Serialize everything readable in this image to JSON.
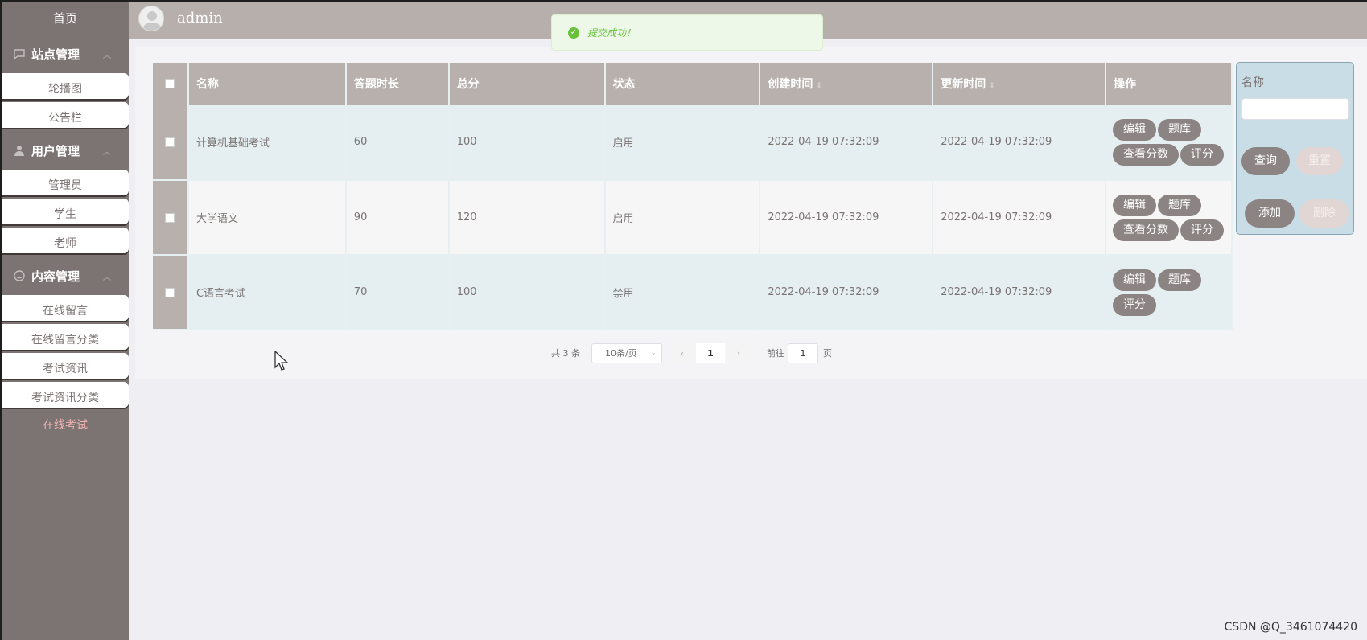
{
  "sidebar": {
    "home": "首页",
    "groups": [
      {
        "title": "站点管理",
        "items": [
          "轮播图",
          "公告栏"
        ]
      },
      {
        "title": "用户管理",
        "items": [
          "管理员",
          "学生",
          "老师"
        ]
      },
      {
        "title": "内容管理",
        "items": [
          "在线留言",
          "在线留言分类",
          "考试资讯",
          "考试资讯分类"
        ]
      }
    ],
    "active": "在线考试"
  },
  "header": {
    "username": "admin"
  },
  "toast": {
    "message": "提交成功！"
  },
  "table": {
    "columns": [
      "名称",
      "答题时长",
      "总分",
      "状态",
      "创建时间",
      "更新时间",
      "操作"
    ],
    "rows": [
      {
        "name": "计算机基础考试",
        "duration": "60",
        "score": "100",
        "status": "启用",
        "created": "2022-04-19 07:32:09",
        "updated": "2022-04-19 07:32:09",
        "actions": [
          [
            "编辑",
            "题库"
          ],
          [
            "查看分数",
            "评分"
          ]
        ]
      },
      {
        "name": "大学语文",
        "duration": "90",
        "score": "120",
        "status": "启用",
        "created": "2022-04-19 07:32:09",
        "updated": "2022-04-19 07:32:09",
        "actions": [
          [
            "编辑",
            "题库"
          ],
          [
            "查看分数",
            "评分"
          ]
        ]
      },
      {
        "name": "C语言考试",
        "duration": "70",
        "score": "100",
        "status": "禁用",
        "created": "2022-04-19 07:32:09",
        "updated": "2022-04-19 07:32:09",
        "actions": [
          [
            "编辑",
            "题库"
          ],
          [
            "评分"
          ]
        ]
      }
    ]
  },
  "search": {
    "label": "名称",
    "query": "查询",
    "reset": "重置",
    "add": "添加",
    "delete": "删除"
  },
  "pager": {
    "total": "共 3 条",
    "page_size": "10条/页",
    "current": "1",
    "goto_prefix": "前往",
    "goto_value": "1",
    "goto_suffix": "页"
  },
  "watermark": "CSDN @Q_3461074420"
}
